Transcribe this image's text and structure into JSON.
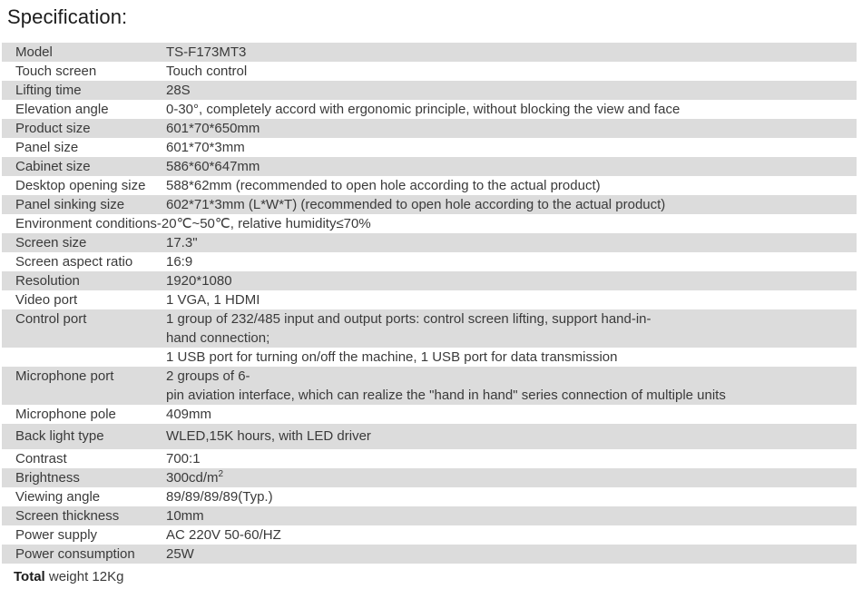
{
  "page": {
    "title": "Specification:"
  },
  "colors": {
    "row_shade": "#dcdcdc",
    "row_plain": "#ffffff",
    "text": "#3a3a3a",
    "title_text": "#1c1c1c"
  },
  "spec": {
    "rows": [
      {
        "label": "Model",
        "value": "TS-F173MT3"
      },
      {
        "label": "Touch screen",
        "value": "Touch control"
      },
      {
        "label": "Lifting time",
        "value": "28S"
      },
      {
        "label": "Elevation angle",
        "value": "0-30°, completely accord with ergonomic principle, without blocking the view and face"
      },
      {
        "label": "Product size",
        "value": "601*70*650mm"
      },
      {
        "label": "Panel size",
        "value": "601*70*3mm"
      },
      {
        "label": "Cabinet size",
        "value": "586*60*647mm"
      },
      {
        "label": "Desktop opening size",
        "value": "588*62mm (recommended to open hole according to the actual product)"
      },
      {
        "label": "Panel sinking size",
        "value": "602*71*3mm (L*W*T) (recommended to open hole according to the actual product)"
      },
      {
        "label": "Environment conditions",
        "value": "-20℃~50℃, relative humidity≤70%"
      },
      {
        "label": "Screen size",
        "value": "17.3\""
      },
      {
        "label": "Screen aspect ratio",
        "value": "16:9"
      },
      {
        "label": "Resolution",
        "value": "1920*1080"
      },
      {
        "label": "Video port",
        "value": "1 VGA, 1 HDMI"
      },
      {
        "label": "Control port",
        "value": "1 group of 232/485 input and output ports: control screen lifting, support hand-in-\nhand connection;"
      },
      {
        "label": "",
        "value": "1 USB port for turning on/off the machine, 1 USB port for data transmission"
      },
      {
        "label": "Microphone port",
        "value": "2 groups of 6-\npin aviation interface, which can realize the \"hand in hand\" series connection of multiple units"
      },
      {
        "label": "Microphone pole",
        "value": "409mm"
      },
      {
        "label": "Back light type",
        "value": "WLED,15K hours,  with LED driver"
      },
      {
        "label": "Contrast",
        "value": "700:1"
      },
      {
        "label": "Brightness",
        "value": "300cd/m2"
      },
      {
        "label": "Viewing angle",
        "value": "89/89/89/89(Typ.)"
      },
      {
        "label": "Screen thickness",
        "value": "10mm"
      },
      {
        "label": "Power supply",
        "value": "AC 220V 50-60/HZ"
      },
      {
        "label": "Power consumption",
        "value": "25W"
      }
    ]
  },
  "footer": {
    "total_label": "Total",
    "total_text": " weight 12Kg"
  }
}
